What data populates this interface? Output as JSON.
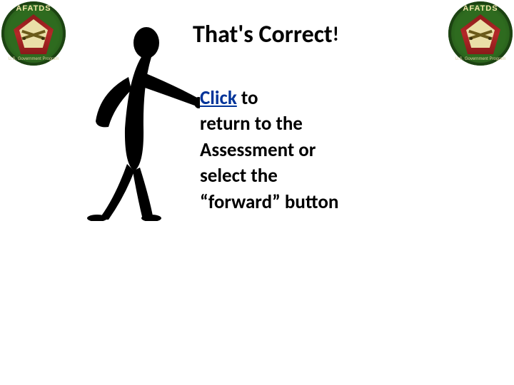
{
  "logo": {
    "top_text": "AFATDS",
    "bottom_text": "U.S. Government Program"
  },
  "title": {
    "main": "That's Correct",
    "exclaim": "!"
  },
  "body": {
    "click_label": "Click",
    "line1_rest": " to",
    "line2": "return to the",
    "line3": "Assessment or",
    "line4": "select  the",
    "line5": "“forward” button"
  }
}
